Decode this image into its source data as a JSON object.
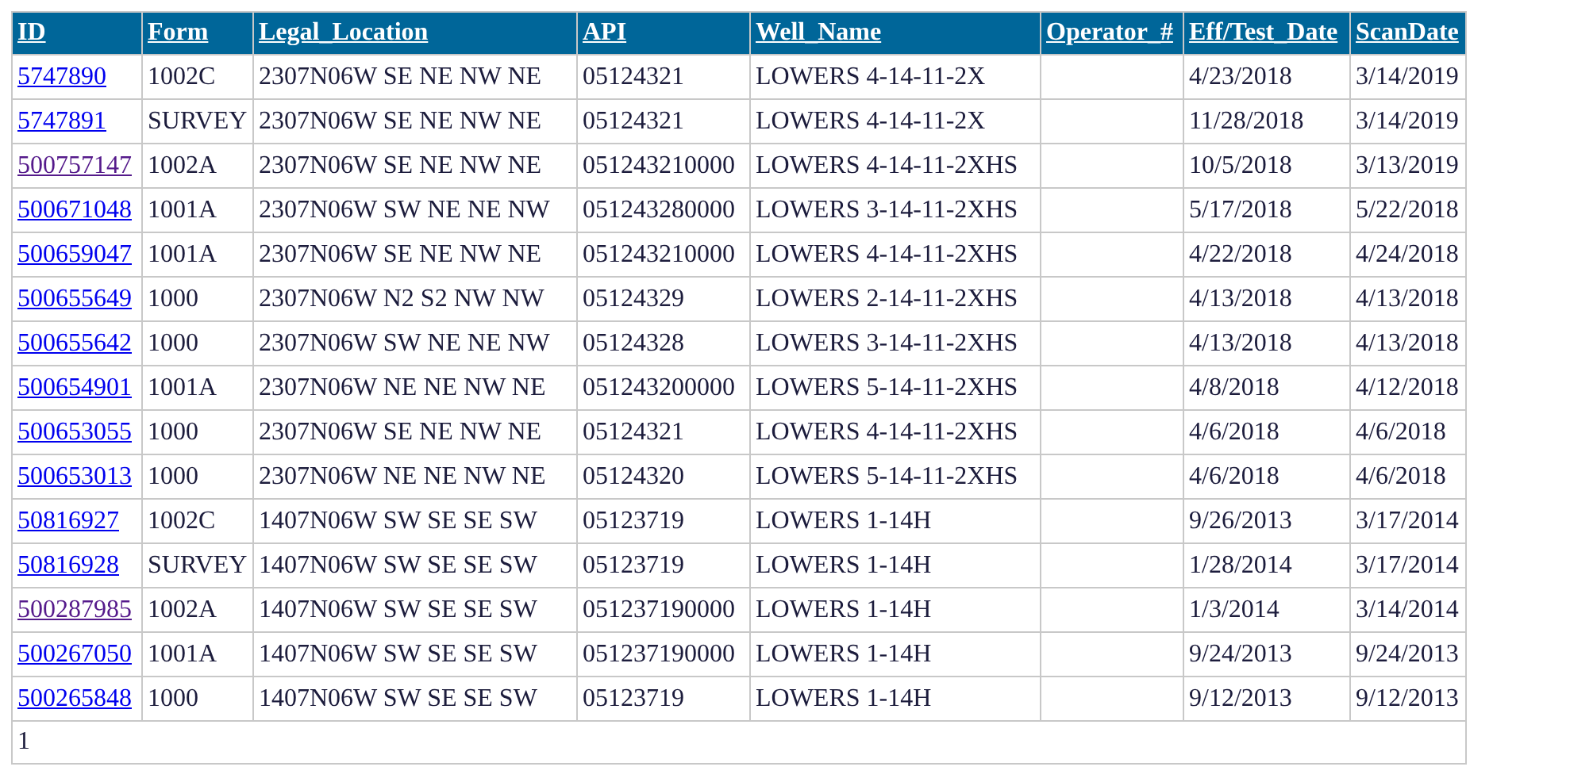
{
  "table": {
    "columns": [
      "ID",
      "Form",
      "Legal_Location",
      "API",
      "Well_Name",
      "Operator_#",
      "Eff/Test_Date",
      "ScanDate"
    ],
    "rows": [
      {
        "id": "5747890",
        "visited": false,
        "form": "1002C",
        "legal_location": "2307N06W SE NE NW NE",
        "api": "05124321",
        "well_name": "LOWERS 4-14-11-2X",
        "eff_test_date": "4/23/2018",
        "scan_date": "3/14/2019"
      },
      {
        "id": "5747891",
        "visited": false,
        "form": "SURVEY",
        "legal_location": "2307N06W SE NE NW NE",
        "api": "05124321",
        "well_name": "LOWERS 4-14-11-2X",
        "eff_test_date": "11/28/2018",
        "scan_date": "3/14/2019"
      },
      {
        "id": "500757147",
        "visited": true,
        "form": "1002A",
        "legal_location": "2307N06W SE NE NW NE",
        "api": "051243210000",
        "well_name": "LOWERS 4-14-11-2XHS",
        "eff_test_date": "10/5/2018",
        "scan_date": "3/13/2019"
      },
      {
        "id": "500671048",
        "visited": false,
        "form": "1001A",
        "legal_location": "2307N06W SW NE NE NW",
        "api": "051243280000",
        "well_name": "LOWERS 3-14-11-2XHS",
        "eff_test_date": "5/17/2018",
        "scan_date": "5/22/2018"
      },
      {
        "id": "500659047",
        "visited": false,
        "form": "1001A",
        "legal_location": "2307N06W SE NE NW NE",
        "api": "051243210000",
        "well_name": "LOWERS 4-14-11-2XHS",
        "eff_test_date": "4/22/2018",
        "scan_date": "4/24/2018"
      },
      {
        "id": "500655649",
        "visited": false,
        "form": "1000",
        "legal_location": "2307N06W N2 S2 NW NW",
        "api": "05124329",
        "well_name": "LOWERS 2-14-11-2XHS",
        "eff_test_date": "4/13/2018",
        "scan_date": "4/13/2018"
      },
      {
        "id": "500655642",
        "visited": false,
        "form": "1000",
        "legal_location": "2307N06W SW NE NE NW",
        "api": "05124328",
        "well_name": "LOWERS 3-14-11-2XHS",
        "eff_test_date": "4/13/2018",
        "scan_date": "4/13/2018"
      },
      {
        "id": "500654901",
        "visited": false,
        "form": "1001A",
        "legal_location": "2307N06W NE NE NW NE",
        "api": "051243200000",
        "well_name": "LOWERS 5-14-11-2XHS",
        "eff_test_date": "4/8/2018",
        "scan_date": "4/12/2018"
      },
      {
        "id": "500653055",
        "visited": false,
        "form": "1000",
        "legal_location": "2307N06W SE NE NW NE",
        "api": "05124321",
        "well_name": "LOWERS 4-14-11-2XHS",
        "eff_test_date": "4/6/2018",
        "scan_date": "4/6/2018"
      },
      {
        "id": "500653013",
        "visited": false,
        "form": "1000",
        "legal_location": "2307N06W NE NE NW NE",
        "api": "05124320",
        "well_name": "LOWERS 5-14-11-2XHS",
        "eff_test_date": "4/6/2018",
        "scan_date": "4/6/2018"
      },
      {
        "id": "50816927",
        "visited": false,
        "form": "1002C",
        "legal_location": "1407N06W SW SE SE SW",
        "api": "05123719",
        "well_name": "LOWERS 1-14H",
        "eff_test_date": "9/26/2013",
        "scan_date": "3/17/2014"
      },
      {
        "id": "50816928",
        "visited": false,
        "form": "SURVEY",
        "legal_location": "1407N06W SW SE SE SW",
        "api": "05123719",
        "well_name": "LOWERS 1-14H",
        "eff_test_date": "1/28/2014",
        "scan_date": "3/17/2014"
      },
      {
        "id": "500287985",
        "visited": true,
        "form": "1002A",
        "legal_location": "1407N06W SW SE SE SW",
        "api": "051237190000",
        "well_name": "LOWERS 1-14H",
        "eff_test_date": "1/3/2014",
        "scan_date": "3/14/2014"
      },
      {
        "id": "500267050",
        "visited": false,
        "form": "1001A",
        "legal_location": "1407N06W SW SE SE SW",
        "api": "051237190000",
        "well_name": "LOWERS 1-14H",
        "eff_test_date": "9/24/2013",
        "scan_date": "9/24/2013"
      },
      {
        "id": "500265848",
        "visited": false,
        "form": "1000",
        "legal_location": "1407N06W SW SE SE SW",
        "api": "05123719",
        "well_name": "LOWERS 1-14H",
        "eff_test_date": "9/12/2013",
        "scan_date": "9/12/2013"
      }
    ],
    "pager": "1"
  }
}
